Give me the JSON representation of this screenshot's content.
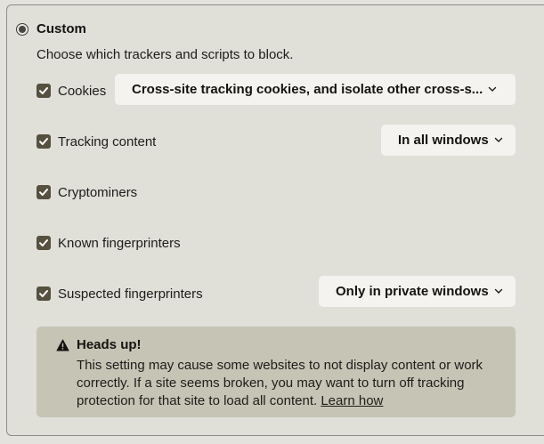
{
  "custom": {
    "label": "Custom",
    "selected": true,
    "description": "Choose which trackers and scripts to block."
  },
  "options": {
    "cookies": {
      "label": "Cookies",
      "checked": true,
      "dropdown_value": "Cross-site tracking cookies, and isolate other cross-s..."
    },
    "tracking_content": {
      "label": "Tracking content",
      "checked": true,
      "dropdown_value": "In all windows"
    },
    "cryptominers": {
      "label": "Cryptominers",
      "checked": true
    },
    "known_fingerprinters": {
      "label": "Known fingerprinters",
      "checked": true
    },
    "suspected_fingerprinters": {
      "label": "Suspected fingerprinters",
      "checked": true,
      "dropdown_value": "Only in private windows"
    }
  },
  "warning": {
    "title": "Heads up!",
    "body": "This setting may cause some websites to not display content or work correctly. If a site seems broken, you may want to turn off tracking protection for that site to load all content.",
    "link": "Learn how",
    "icon": "warning-icon"
  },
  "icons": {
    "checkbox": "checkmark-icon",
    "dropdown": "chevron-down-icon"
  },
  "colors": {
    "background": "#e3e2dc",
    "checkbox_fill": "#55503f",
    "dropdown_bg": "#f4f3ef",
    "warning_bg": "#c6c4b5"
  }
}
